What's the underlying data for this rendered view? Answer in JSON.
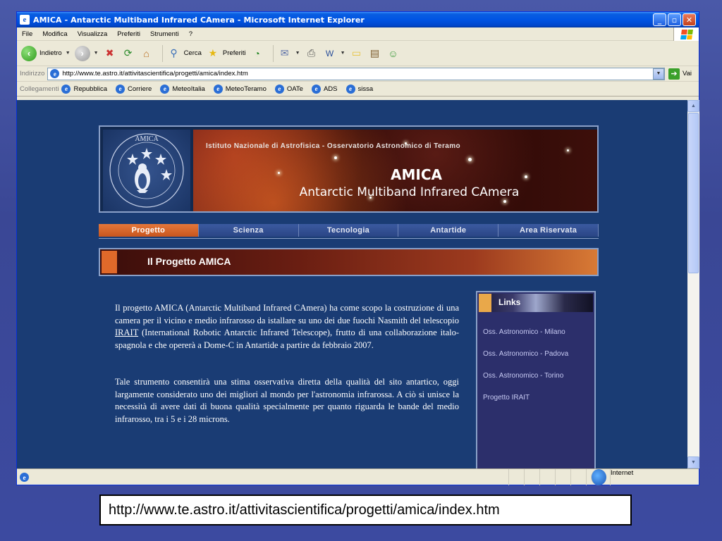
{
  "window": {
    "title": "AMICA - Antarctic Multiband Infrared CAmera - Microsoft Internet Explorer",
    "controls": {
      "minimize": "_",
      "maximize": "▫",
      "close": "✕"
    }
  },
  "menu": [
    "File",
    "Modifica",
    "Visualizza",
    "Preferiti",
    "Strumenti",
    "?"
  ],
  "toolbar": {
    "back_label": "Indietro",
    "search_label": "Cerca",
    "favorites_label": "Preferiti"
  },
  "address": {
    "label": "Indirizzo",
    "url": "http://www.te.astro.it/attivitascientifica/progetti/amica/index.htm",
    "go_label": "Vai"
  },
  "links_bar": {
    "label": "Collegamenti",
    "items": [
      "Repubblica",
      "Corriere",
      "MeteoItalia",
      "MeteoTeramo",
      "OATe",
      "ADS",
      "sissa"
    ]
  },
  "status": {
    "zone": "Internet"
  },
  "page": {
    "logo_text": "AMICA",
    "banner_institute": "Istituto Nazionale di Astrofisica - Osservatorio Astronomico di Teramo",
    "banner_title": "AMICA",
    "banner_subtitle": "Antarctic Multiband Infrared CAmera",
    "nav": [
      "Progetto",
      "Scienza",
      "Tecnologia",
      "Antartide",
      "Area Riservata"
    ],
    "section_title": "Il Progetto AMICA",
    "para1_a": "Il progetto AMICA (Antarctic Multiband Infrared CAmera) ha come scopo la costruzione di una camera per il vicino e medio infrarosso da istallare su uno dei due fuochi Nasmith del telescopio ",
    "para1_link": "IRAIT",
    "para1_b": " (International Robotic Antarctic Infrared Telescope), frutto di una collaborazione italo-spagnola e che opererà a Dome-C in Antartide a partire da febbraio 2007.",
    "para2": "Tale strumento consentirà una stima osservativa diretta della qualità del sito antartico, oggi largamente considerato uno dei migliori al mondo per l'astronomia infrarossa. A ciò si unisce la necessità di avere dati di buona qualità specialmente per quanto riguarda le bande del medio infrarosso, tra i 5 e i 28 microns.",
    "links_title": "Links",
    "links": [
      "Oss. Astronomico - Milano",
      "Oss. Astronomico - Padova",
      "Oss. Astronomico - Torino",
      "Progetto IRAIT"
    ]
  },
  "caption": "http://www.te.astro.it/attivitascientifica/progetti/amica/index.htm"
}
